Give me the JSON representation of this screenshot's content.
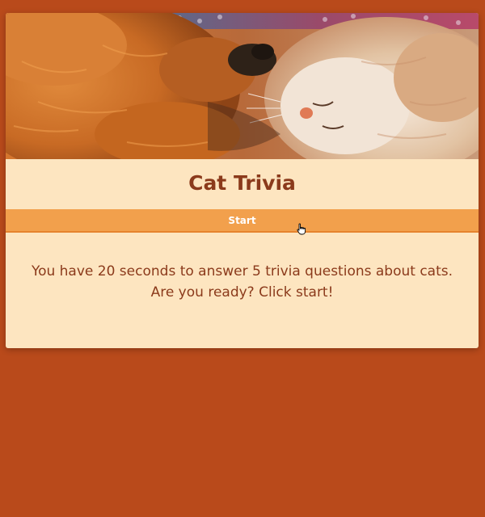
{
  "card": {
    "hero_alt": "two cats sleeping",
    "title": "Cat Trivia",
    "start_label": "Start",
    "description": "You have 20 seconds to answer 5 trivia questions about cats. Are you ready? Click start!"
  },
  "colors": {
    "page_background": "#b94a1b",
    "card_background": "#fde5c0",
    "title_text": "#8b3a1b",
    "button_background": "#f2a04c",
    "button_text": "#ffffff"
  },
  "icons": {
    "cursor": "hand-pointer-icon"
  }
}
